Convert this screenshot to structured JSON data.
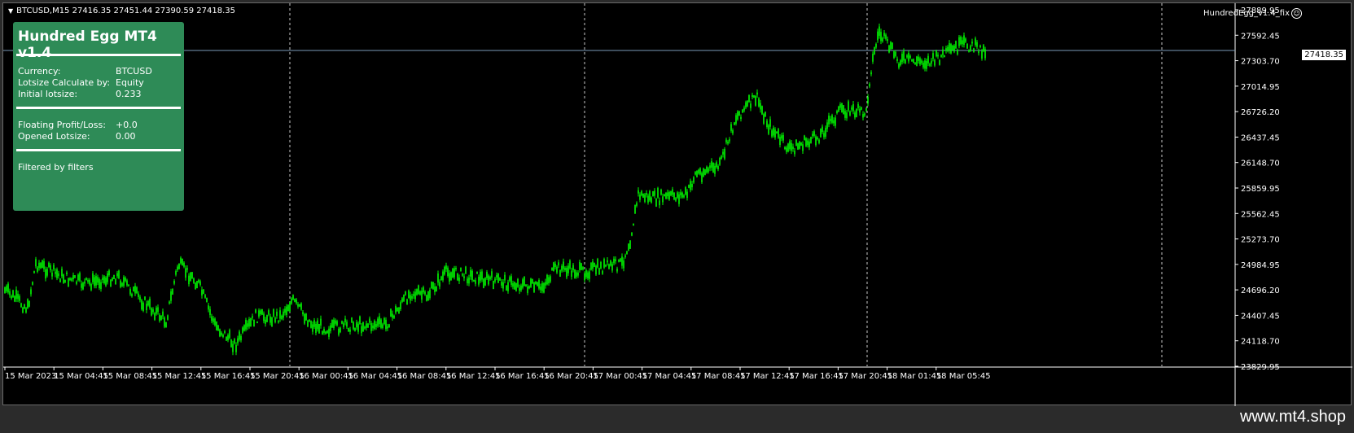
{
  "chart": {
    "symbol_line": "BTCUSD,M15  27416.35 27451.44 27390.59 27418.35",
    "ea_label": "HundredEgg_v1.4_fix",
    "bid_price": "27418.35",
    "price_axis": [
      "27889.95",
      "27592.45",
      "27303.70",
      "27014.95",
      "26726.20",
      "26437.45",
      "26148.70",
      "25859.95",
      "25562.45",
      "25273.70",
      "24984.95",
      "24696.20",
      "24407.45",
      "24118.70",
      "23829.95"
    ],
    "time_axis": [
      "15 Mar 2023",
      "15 Mar 04:45",
      "15 Mar 08:45",
      "15 Mar 12:45",
      "15 Mar 16:45",
      "15 Mar 20:45",
      "16 Mar 00:45",
      "16 Mar 04:45",
      "16 Mar 08:45",
      "16 Mar 12:45",
      "16 Mar 16:45",
      "16 Mar 20:45",
      "17 Mar 00:45",
      "17 Mar 04:45",
      "17 Mar 08:45",
      "17 Mar 12:45",
      "17 Mar 16:45",
      "17 Mar 20:45",
      "18 Mar 01:45",
      "18 Mar 05:45"
    ],
    "colors": {
      "background": "#000000",
      "candles": "#00ff00",
      "separators": "#c8c8c8",
      "bid_line": "#7a9ab8",
      "axis_text": "#ffffff"
    },
    "price_range": [
      23829.95,
      27889.95
    ]
  },
  "panel": {
    "title": "Hundred Egg MT4 v1.4",
    "currency_label": "Currency:",
    "currency_value": "BTCUSD",
    "lotsize_calc_label": "Lotsize Calculate by:",
    "lotsize_calc_value": "Equity",
    "initial_lotsize_label": "Initial lotsize:",
    "initial_lotsize_value": "0.233",
    "floating_pl_label": "Floating Profit/Loss:",
    "floating_pl_value": "+0.0",
    "opened_lotsize_label": "Opened Lotsize:",
    "opened_lotsize_value": "0.00",
    "status": "Filtered by filters",
    "background": "#2e8b57"
  },
  "watermark": "www.mt4.shop",
  "icons": {
    "ea_status": "smiley-icon",
    "symbol_menu": "caret-down-icon"
  }
}
